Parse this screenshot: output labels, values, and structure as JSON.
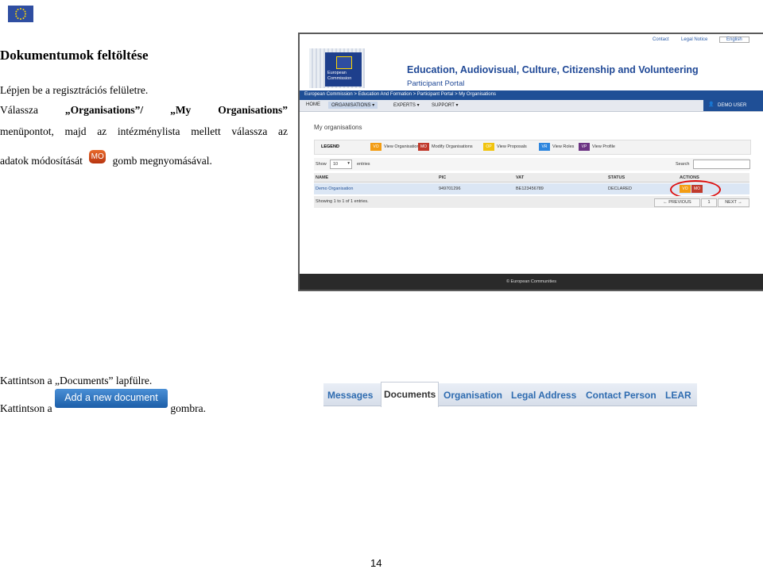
{
  "header": {
    "logo_icon": "eu-flag-icon"
  },
  "section": {
    "title": "Dokumentumok feltöltése",
    "line1": "Lépjen be a regisztrációs felületre.",
    "line2_a": "Válassza",
    "line2_b": "„Organisations”/",
    "line2_c": "„My",
    "line2_d": "Organisations”",
    "line3_words": [
      "menüpontot,",
      "majd",
      "az",
      "intézménylista",
      "mellett",
      "válassza",
      "az"
    ],
    "line4_a": "adatok módosítását",
    "line4_b": "gomb megnyomásával.",
    "mo_button": "MO"
  },
  "portal": {
    "top_links": [
      "Contact",
      "Legal Notice",
      "English"
    ],
    "brand_title": "Education, Audiovisual, Culture, Citizenship and Volunteering",
    "brand_subtitle": "Participant Portal",
    "logo_text": [
      "European",
      "Commission"
    ],
    "breadcrumb": "European Commission > Education And Formation > Participant Portal > My Organisations",
    "nav": [
      "HOME",
      "ORGANISATIONS",
      "EXPERTS",
      "SUPPORT"
    ],
    "demo_user": "DEMO USER",
    "page_heading": "My organisations",
    "legend_label": "LEGEND",
    "legend": [
      {
        "code": "VO",
        "label": "View Organisations",
        "color": "#f39c12"
      },
      {
        "code": "MO",
        "label": "Modify Organisations",
        "color": "#c0392b"
      },
      {
        "code": "OP",
        "label": "View Proposals",
        "color": "#f1c40f"
      },
      {
        "code": "VR",
        "label": "View Roles",
        "color": "#2e86de"
      },
      {
        "code": "VP",
        "label": "View Profile",
        "color": "#6c3483"
      }
    ],
    "show_label": "Show",
    "show_value": "10",
    "entries_label": "entries",
    "search_label": "Search",
    "columns": [
      "NAME",
      "PIC",
      "VAT",
      "STATUS",
      "ACTIONS"
    ],
    "row": {
      "name": "Demo Organisation",
      "pic": "949701296",
      "vat": "BE123456789",
      "status": "DECLARED"
    },
    "row_actions": [
      "VO",
      "MO"
    ],
    "info": "Showing 1 to 1 of 1 entries.",
    "pager": [
      "← PREVIOUS",
      "1",
      "NEXT →"
    ],
    "footer": "© European Communities"
  },
  "instructions": {
    "line5": "Kattintson a „Documents” lapfülre.",
    "line6_a": "Kattintson a",
    "line6_b": "gombra.",
    "add_button": "Add a new document"
  },
  "tabs": [
    "Messages",
    "Documents",
    "Organisation",
    "Legal Address",
    "Contact Person",
    "LEAR"
  ],
  "page_number": "14"
}
